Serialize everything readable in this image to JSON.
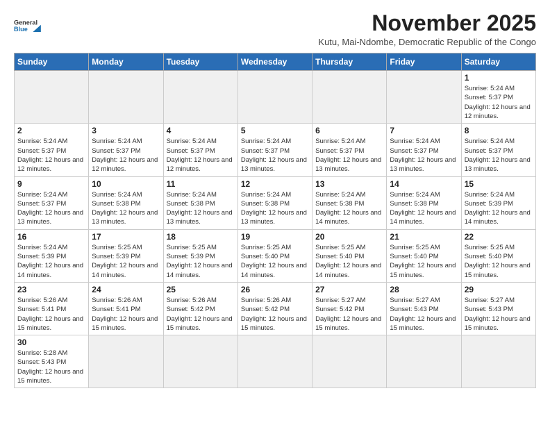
{
  "header": {
    "logo_general": "General",
    "logo_blue": "Blue",
    "month_year": "November 2025",
    "subtitle": "Kutu, Mai-Ndombe, Democratic Republic of the Congo"
  },
  "weekdays": [
    "Sunday",
    "Monday",
    "Tuesday",
    "Wednesday",
    "Thursday",
    "Friday",
    "Saturday"
  ],
  "weeks": [
    [
      {
        "day": "",
        "empty": true
      },
      {
        "day": "",
        "empty": true
      },
      {
        "day": "",
        "empty": true
      },
      {
        "day": "",
        "empty": true
      },
      {
        "day": "",
        "empty": true
      },
      {
        "day": "",
        "empty": true
      },
      {
        "day": "1",
        "sunrise": "5:24 AM",
        "sunset": "5:37 PM",
        "daylight": "12 hours and 12 minutes."
      }
    ],
    [
      {
        "day": "2",
        "sunrise": "5:24 AM",
        "sunset": "5:37 PM",
        "daylight": "12 hours and 12 minutes."
      },
      {
        "day": "3",
        "sunrise": "5:24 AM",
        "sunset": "5:37 PM",
        "daylight": "12 hours and 12 minutes."
      },
      {
        "day": "4",
        "sunrise": "5:24 AM",
        "sunset": "5:37 PM",
        "daylight": "12 hours and 12 minutes."
      },
      {
        "day": "5",
        "sunrise": "5:24 AM",
        "sunset": "5:37 PM",
        "daylight": "12 hours and 13 minutes."
      },
      {
        "day": "6",
        "sunrise": "5:24 AM",
        "sunset": "5:37 PM",
        "daylight": "12 hours and 13 minutes."
      },
      {
        "day": "7",
        "sunrise": "5:24 AM",
        "sunset": "5:37 PM",
        "daylight": "12 hours and 13 minutes."
      },
      {
        "day": "8",
        "sunrise": "5:24 AM",
        "sunset": "5:37 PM",
        "daylight": "12 hours and 13 minutes."
      }
    ],
    [
      {
        "day": "9",
        "sunrise": "5:24 AM",
        "sunset": "5:37 PM",
        "daylight": "12 hours and 13 minutes."
      },
      {
        "day": "10",
        "sunrise": "5:24 AM",
        "sunset": "5:38 PM",
        "daylight": "12 hours and 13 minutes."
      },
      {
        "day": "11",
        "sunrise": "5:24 AM",
        "sunset": "5:38 PM",
        "daylight": "12 hours and 13 minutes."
      },
      {
        "day": "12",
        "sunrise": "5:24 AM",
        "sunset": "5:38 PM",
        "daylight": "12 hours and 13 minutes."
      },
      {
        "day": "13",
        "sunrise": "5:24 AM",
        "sunset": "5:38 PM",
        "daylight": "12 hours and 14 minutes."
      },
      {
        "day": "14",
        "sunrise": "5:24 AM",
        "sunset": "5:38 PM",
        "daylight": "12 hours and 14 minutes."
      },
      {
        "day": "15",
        "sunrise": "5:24 AM",
        "sunset": "5:39 PM",
        "daylight": "12 hours and 14 minutes."
      }
    ],
    [
      {
        "day": "16",
        "sunrise": "5:24 AM",
        "sunset": "5:39 PM",
        "daylight": "12 hours and 14 minutes."
      },
      {
        "day": "17",
        "sunrise": "5:25 AM",
        "sunset": "5:39 PM",
        "daylight": "12 hours and 14 minutes."
      },
      {
        "day": "18",
        "sunrise": "5:25 AM",
        "sunset": "5:39 PM",
        "daylight": "12 hours and 14 minutes."
      },
      {
        "day": "19",
        "sunrise": "5:25 AM",
        "sunset": "5:40 PM",
        "daylight": "12 hours and 14 minutes."
      },
      {
        "day": "20",
        "sunrise": "5:25 AM",
        "sunset": "5:40 PM",
        "daylight": "12 hours and 14 minutes."
      },
      {
        "day": "21",
        "sunrise": "5:25 AM",
        "sunset": "5:40 PM",
        "daylight": "12 hours and 15 minutes."
      },
      {
        "day": "22",
        "sunrise": "5:25 AM",
        "sunset": "5:40 PM",
        "daylight": "12 hours and 15 minutes."
      }
    ],
    [
      {
        "day": "23",
        "sunrise": "5:26 AM",
        "sunset": "5:41 PM",
        "daylight": "12 hours and 15 minutes."
      },
      {
        "day": "24",
        "sunrise": "5:26 AM",
        "sunset": "5:41 PM",
        "daylight": "12 hours and 15 minutes."
      },
      {
        "day": "25",
        "sunrise": "5:26 AM",
        "sunset": "5:42 PM",
        "daylight": "12 hours and 15 minutes."
      },
      {
        "day": "26",
        "sunrise": "5:26 AM",
        "sunset": "5:42 PM",
        "daylight": "12 hours and 15 minutes."
      },
      {
        "day": "27",
        "sunrise": "5:27 AM",
        "sunset": "5:42 PM",
        "daylight": "12 hours and 15 minutes."
      },
      {
        "day": "28",
        "sunrise": "5:27 AM",
        "sunset": "5:43 PM",
        "daylight": "12 hours and 15 minutes."
      },
      {
        "day": "29",
        "sunrise": "5:27 AM",
        "sunset": "5:43 PM",
        "daylight": "12 hours and 15 minutes."
      }
    ],
    [
      {
        "day": "30",
        "sunrise": "5:28 AM",
        "sunset": "5:43 PM",
        "daylight": "12 hours and 15 minutes."
      },
      {
        "day": "",
        "empty": true
      },
      {
        "day": "",
        "empty": true
      },
      {
        "day": "",
        "empty": true
      },
      {
        "day": "",
        "empty": true
      },
      {
        "day": "",
        "empty": true
      },
      {
        "day": "",
        "empty": true
      }
    ]
  ]
}
